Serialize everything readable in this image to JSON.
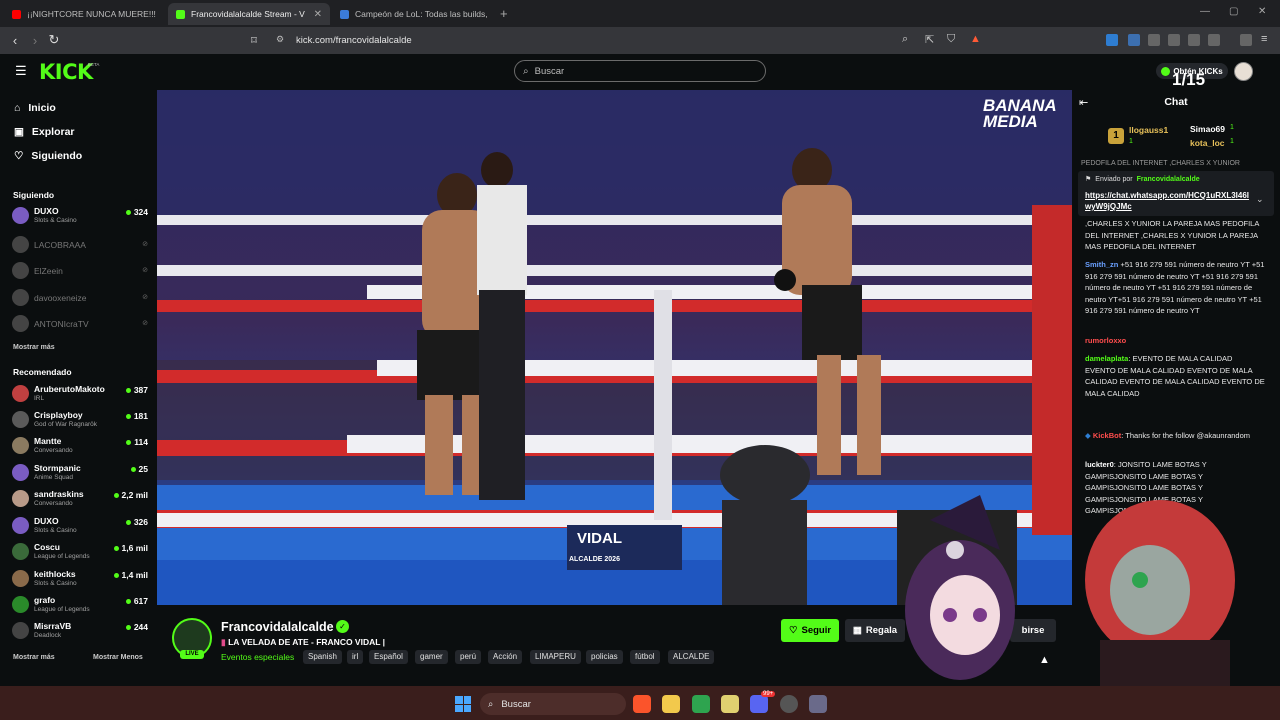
{
  "browser": {
    "tabs": [
      {
        "label": "¡¡NIGHTCORE NUNCA MUERE!!!",
        "color": "#ff0000"
      },
      {
        "label": "Francovidalalcalde Stream - V",
        "color": "#53fc18"
      },
      {
        "label": "Campeón de LoL: Todas las builds, tie",
        "color": "#3b7bd8"
      }
    ],
    "url": "kick.com/francovidalalcalde"
  },
  "site": {
    "logo": "KICK",
    "beta": "BETA",
    "search_placeholder": "Buscar",
    "kicks_button": "Obtén KICKs",
    "accent": "#53fc18"
  },
  "sidebar": {
    "nav": [
      {
        "label": "Inicio",
        "icon": "home-icon"
      },
      {
        "label": "Explorar",
        "icon": "compass-icon"
      },
      {
        "label": "Siguiendo",
        "icon": "heart-icon"
      }
    ],
    "following_title": "Siguiendo",
    "following": [
      {
        "name": "DUXO",
        "category": "Slots & Casino",
        "viewers": "324",
        "live": true,
        "color": "#7a5cc2"
      },
      {
        "name": "LACOBRAAA",
        "live": false,
        "color": "#444"
      },
      {
        "name": "ElZeein",
        "live": false,
        "color": "#444"
      },
      {
        "name": "davooxeneize",
        "live": false,
        "color": "#444"
      },
      {
        "name": "ANTONIcraTV",
        "live": false,
        "color": "#444"
      }
    ],
    "show_more_following": "Mostrar más",
    "recommended_title": "Recomendado",
    "recommended": [
      {
        "name": "AruberutoMakoto",
        "category": "IRL",
        "viewers": "387",
        "color": "#c04040"
      },
      {
        "name": "Crisplayboy",
        "category": "God of War Ragnarök",
        "viewers": "181",
        "color": "#5a5a5a"
      },
      {
        "name": "Mantte",
        "category": "Conversando",
        "viewers": "114",
        "color": "#8a7a60"
      },
      {
        "name": "Stormpanic",
        "category": "Anime Squad",
        "viewers": "25",
        "color": "#7a5cc2"
      },
      {
        "name": "sandraskins",
        "category": "Conversando",
        "viewers": "2,2 mil",
        "color": "#b89a88"
      },
      {
        "name": "DUXO",
        "category": "Slots & Casino",
        "viewers": "326",
        "color": "#7a5cc2"
      },
      {
        "name": "Coscu",
        "category": "League of Legends",
        "viewers": "1,6 mil",
        "color": "#3a6a3a"
      },
      {
        "name": "keithlocks",
        "category": "Slots & Casino",
        "viewers": "1,4 mil",
        "color": "#8a6a4a"
      },
      {
        "name": "grafo",
        "category": "League of Legends",
        "viewers": "617",
        "color": "#2a8a2a"
      },
      {
        "name": "MisrraVB",
        "category": "Deadlock",
        "viewers": "244",
        "color": "#444"
      }
    ],
    "show_more": "Mostrar más",
    "show_less": "Mostrar Menos"
  },
  "video": {
    "watermark": "BANANA MEDIA",
    "banner_name": "VIDAL",
    "banner_sub": "ALCALDE 2026"
  },
  "stream": {
    "streamer": "Francovidalalcalde",
    "live": "LIVE",
    "title": "LA VELADA DE ATE - FRANCO VIDAL |",
    "category": "Eventos especiales",
    "tags": [
      "Spanish",
      "irl",
      "Español",
      "gamer",
      "perú",
      "Acción",
      "LIMAPERU",
      "policias",
      "fútbol",
      "ALCALDE"
    ],
    "follow": "Seguir",
    "gift": "Regala",
    "subscribe": "birse"
  },
  "chat": {
    "title": "Chat",
    "counter": "1/15",
    "leaders": [
      {
        "name": "llogauss1",
        "value": "1"
      },
      {
        "name": "Simao69",
        "value": "1"
      },
      {
        "name": "kota_loc",
        "value": "1"
      }
    ],
    "pinned_label": "Enviado por",
    "pinned_user": "Francovidalalcalde",
    "pinned_link": "https://chat.whatsapp.com/HCQ1uRXL3I46IwyW9jQJMc",
    "pinned_cut": "PEDOFILA DEL INTERNET ,CHARLES X YUNIOR",
    "messages": [
      {
        "user": "",
        "color": "#fff",
        "text": ",CHARLES X YUNIOR LA PAREJA MAS PEDOFILA DEL INTERNET ,CHARLES X YUNIOR LA PAREJA MAS PEDOFILA DEL INTERNET"
      },
      {
        "user": "Smith_zn",
        "color": "#6aa0ff",
        "text": "+51 916 279 591 número de neutro YT +51 916 279 591 número de neutro YT +51 916 279 591 número de neutro YT +51 916 279 591 número de neutro YT+51 916 279 591 número de neutro YT +51 916 279 591 número de neutro YT"
      },
      {
        "user": "rumorloxxo",
        "color": "#ff4d4d",
        "text": ""
      },
      {
        "user": "damelaplata",
        "color": "#53fc18",
        "text": "EVENTO DE MALA CALIDAD EVENTO DE MALA CALIDAD EVENTO DE MALA CALIDAD EVENTO DE MALA CALIDAD EVENTO DE MALA CALIDAD"
      },
      {
        "user": "KickBot",
        "color": "#ff4d4d",
        "text": "Thanks for the follow @akaunrandom"
      },
      {
        "user": "luckter0",
        "color": "#ffffff",
        "text": "JONSITO LAME BOTAS Y GAMPISJONSITO LAME BOTAS Y GAMPISJONSITO LAME BOTAS Y GAMPISJONSITO LAME BOTAS Y GAMPISJONSITO"
      }
    ]
  },
  "taskbar": {
    "search": "Buscar",
    "badge": "99+"
  }
}
